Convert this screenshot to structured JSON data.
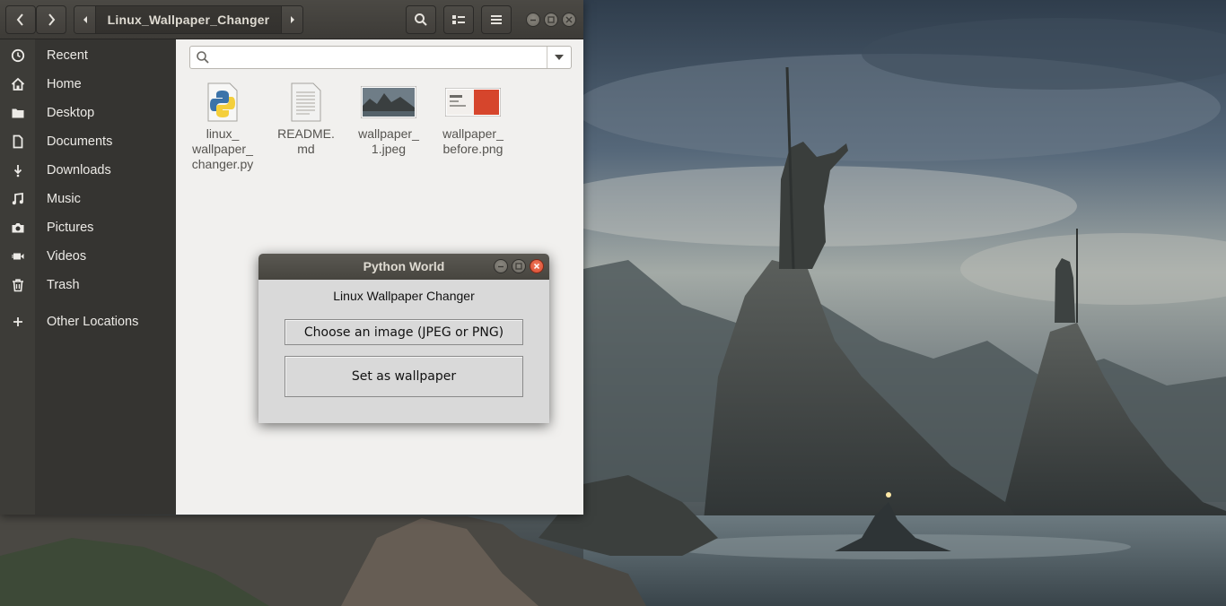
{
  "files_window": {
    "path_current": "Linux_Wallpaper_Changer",
    "sidebar": {
      "items": [
        {
          "label": "Recent",
          "icon": "clock-icon"
        },
        {
          "label": "Home",
          "icon": "home-icon"
        },
        {
          "label": "Desktop",
          "icon": "folder-icon"
        },
        {
          "label": "Documents",
          "icon": "document-icon"
        },
        {
          "label": "Downloads",
          "icon": "download-icon"
        },
        {
          "label": "Music",
          "icon": "music-icon"
        },
        {
          "label": "Pictures",
          "icon": "camera-icon"
        },
        {
          "label": "Videos",
          "icon": "video-icon"
        },
        {
          "label": "Trash",
          "icon": "trash-icon"
        },
        {
          "label": "Other Locations",
          "icon": "plus-icon"
        }
      ]
    },
    "search": {
      "value": "",
      "placeholder": ""
    },
    "files": [
      {
        "name": "linux_\nwallpaper_\nchanger.py",
        "icon": "python-file-icon"
      },
      {
        "name": "README.\nmd",
        "icon": "text-file-icon"
      },
      {
        "name": "wallpaper_\n1.jpeg",
        "icon": "image-thumbnail"
      },
      {
        "name": "wallpaper_\nbefore.png",
        "icon": "image-thumbnail"
      }
    ]
  },
  "dialog": {
    "title": "Python World",
    "heading": "Linux Wallpaper Changer",
    "choose_button": "Choose an image (JPEG or PNG)",
    "set_button": "Set as wallpaper"
  },
  "colors": {
    "headerbar": "#3d3b37",
    "sidebar": "#353431",
    "content_bg": "#f1f0ee",
    "dialog_bg": "#d9d9d9",
    "close_red": "#e2503a"
  }
}
